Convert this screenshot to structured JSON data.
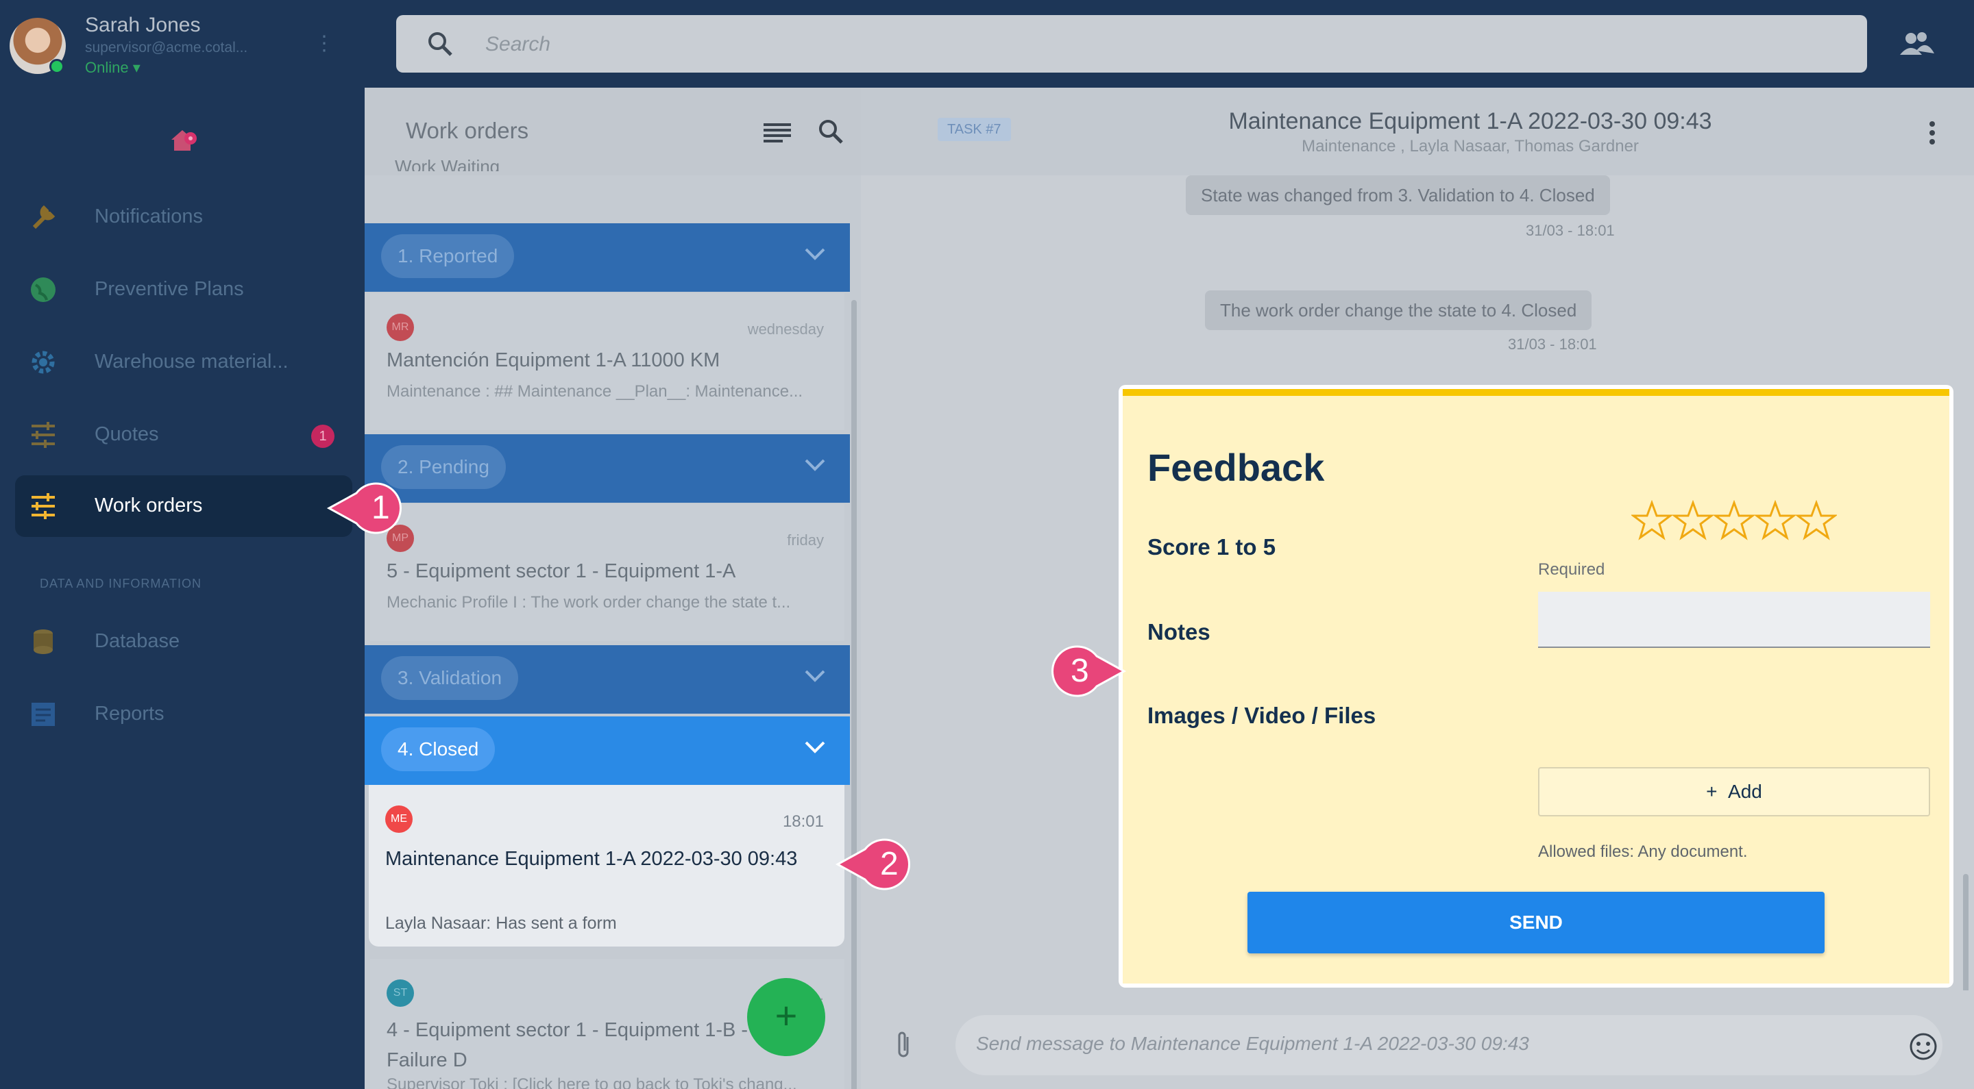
{
  "user": {
    "name": "Sarah Jones",
    "email": "supervisor@acme.cotal...",
    "status": "Online"
  },
  "search": {
    "placeholder": "Search"
  },
  "sidebar": {
    "items": [
      {
        "label": "Notifications",
        "icon": "wrench-icon"
      },
      {
        "label": "Preventive Plans",
        "icon": "globe-icon"
      },
      {
        "label": "Warehouse material...",
        "icon": "gear-icon"
      },
      {
        "label": "Quotes",
        "icon": "sliders-icon",
        "badge": "1"
      },
      {
        "label": "Work orders",
        "icon": "sliders-icon",
        "active": true
      },
      {
        "label": "Database",
        "icon": "database-icon"
      },
      {
        "label": "Reports",
        "icon": "report-icon"
      }
    ],
    "section_title": "DATA AND INFORMATION"
  },
  "list": {
    "title": "Work orders",
    "peek_text": "Work Waiting",
    "groups": [
      {
        "label": "1. Reported"
      },
      {
        "label": "2. Pending"
      },
      {
        "label": "3. Validation"
      },
      {
        "label": "4. Closed"
      }
    ],
    "cards": [
      {
        "avatar": "MR",
        "time": "wednesday",
        "title": "Mantención Equipment 1-A 11000 KM",
        "subtitle": "Maintenance : ## Maintenance __Plan__: Maintenance..."
      },
      {
        "avatar": "MP",
        "time": "friday",
        "title": "5 - Equipment sector 1 - Equipment 1-A",
        "subtitle": "Mechanic Profile I : The work order change the state t..."
      },
      {
        "avatar": "ME",
        "time": "18:01",
        "title": "Maintenance Equipment 1-A 2022-03-30 09:43",
        "subtitle": "Layla Nasaar: Has sent a form"
      },
      {
        "avatar": "ST",
        "time": "...",
        "title": "4 - Equipment sector 1 - Equipment 1-B - Failure D",
        "subtitle": "Supervisor Toki : [Click here to go back to Toki's chang..."
      }
    ],
    "fab_label": "+"
  },
  "chat": {
    "task_badge": "TASK #7",
    "title": "Maintenance Equipment 1-A 2022-03-30 09:43",
    "subtitle": "Maintenance , Layla Nasaar, Thomas Gardner",
    "messages": [
      {
        "text": "State was changed from 3. Validation to 4. Closed",
        "time": "31/03 - 18:01"
      },
      {
        "text": "The work order change the state to 4. Closed",
        "time": "31/03 - 18:01"
      }
    ],
    "composer_placeholder": "Send message to Maintenance Equipment 1-A 2022-03-30 09:43"
  },
  "feedback": {
    "title": "Feedback",
    "score_label": "Score 1 to 5",
    "required_text": "Required",
    "notes_label": "Notes",
    "files_label": "Images / Video / Files",
    "add_label": "Add",
    "allowed_text": "Allowed files: Any document.",
    "send_label": "SEND",
    "stars_count": 5,
    "score_value": 0
  },
  "callouts": [
    "1",
    "2",
    "3"
  ],
  "colors": {
    "accent": "#1f86ea",
    "callout": "#e8457a",
    "form_bg": "#fff3c4",
    "form_top": "#f7c600"
  }
}
